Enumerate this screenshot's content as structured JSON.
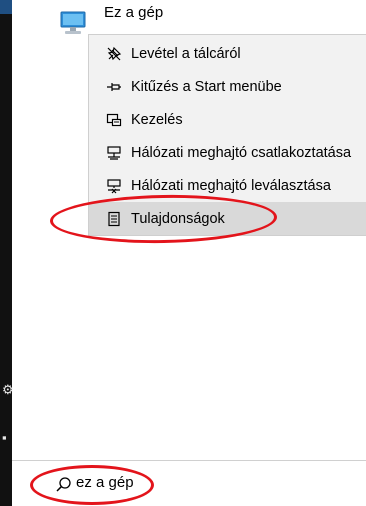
{
  "app_result": {
    "title": "Ez a gép",
    "icon": "computer-icon"
  },
  "context_menu": {
    "items": [
      {
        "label": "Levétel a tálcáról",
        "icon": "unpin-taskbar-icon"
      },
      {
        "label": "Kitűzés a Start menübe",
        "icon": "pin-icon"
      },
      {
        "label": "Kezelés",
        "icon": "computer-management-icon"
      },
      {
        "label": "Hálózati meghajtó csatlakoztatása",
        "icon": "map-network-drive-icon"
      },
      {
        "label": "Hálózati meghajtó leválasztása",
        "icon": "disconnect-network-drive-icon"
      },
      {
        "label": "Tulajdonságok",
        "icon": "properties-icon",
        "selected": true
      }
    ]
  },
  "search": {
    "query": "ez a gép",
    "icon": "search-icon"
  },
  "rail": {
    "icons": [
      "settings-icon",
      "power-icon"
    ]
  },
  "colors": {
    "annotation": "#e3141b",
    "menu_bg": "#f2f2f2",
    "menu_selected": "#d9d9d9",
    "rail": "#111111"
  }
}
